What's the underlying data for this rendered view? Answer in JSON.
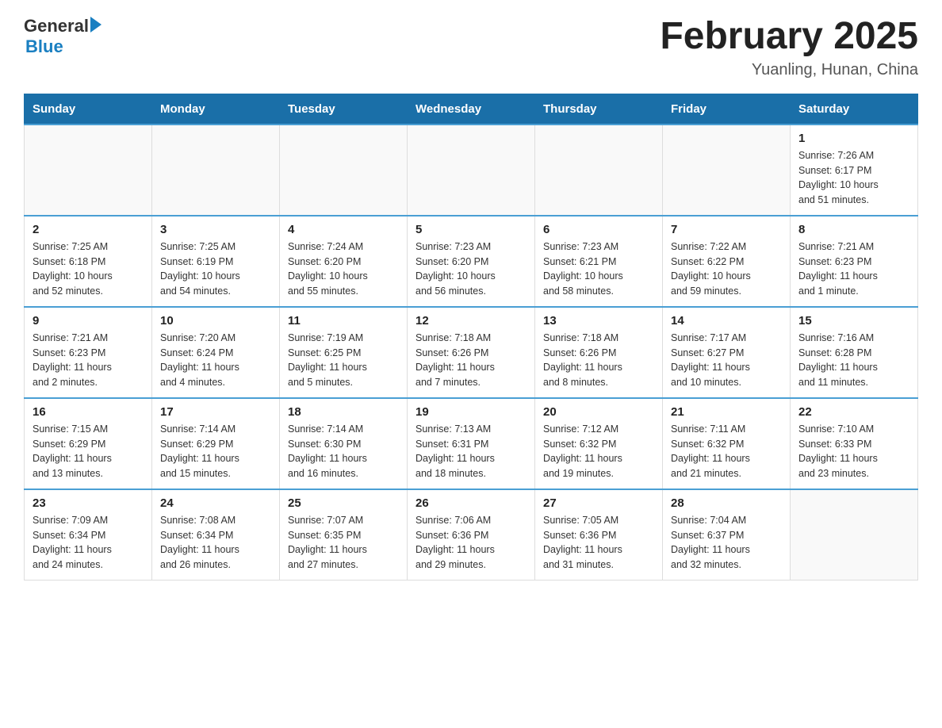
{
  "header": {
    "logo_general": "General",
    "logo_blue": "Blue",
    "title": "February 2025",
    "subtitle": "Yuanling, Hunan, China"
  },
  "days_of_week": [
    "Sunday",
    "Monday",
    "Tuesday",
    "Wednesday",
    "Thursday",
    "Friday",
    "Saturday"
  ],
  "weeks": [
    [
      {
        "day": "",
        "info": ""
      },
      {
        "day": "",
        "info": ""
      },
      {
        "day": "",
        "info": ""
      },
      {
        "day": "",
        "info": ""
      },
      {
        "day": "",
        "info": ""
      },
      {
        "day": "",
        "info": ""
      },
      {
        "day": "1",
        "info": "Sunrise: 7:26 AM\nSunset: 6:17 PM\nDaylight: 10 hours\nand 51 minutes."
      }
    ],
    [
      {
        "day": "2",
        "info": "Sunrise: 7:25 AM\nSunset: 6:18 PM\nDaylight: 10 hours\nand 52 minutes."
      },
      {
        "day": "3",
        "info": "Sunrise: 7:25 AM\nSunset: 6:19 PM\nDaylight: 10 hours\nand 54 minutes."
      },
      {
        "day": "4",
        "info": "Sunrise: 7:24 AM\nSunset: 6:20 PM\nDaylight: 10 hours\nand 55 minutes."
      },
      {
        "day": "5",
        "info": "Sunrise: 7:23 AM\nSunset: 6:20 PM\nDaylight: 10 hours\nand 56 minutes."
      },
      {
        "day": "6",
        "info": "Sunrise: 7:23 AM\nSunset: 6:21 PM\nDaylight: 10 hours\nand 58 minutes."
      },
      {
        "day": "7",
        "info": "Sunrise: 7:22 AM\nSunset: 6:22 PM\nDaylight: 10 hours\nand 59 minutes."
      },
      {
        "day": "8",
        "info": "Sunrise: 7:21 AM\nSunset: 6:23 PM\nDaylight: 11 hours\nand 1 minute."
      }
    ],
    [
      {
        "day": "9",
        "info": "Sunrise: 7:21 AM\nSunset: 6:23 PM\nDaylight: 11 hours\nand 2 minutes."
      },
      {
        "day": "10",
        "info": "Sunrise: 7:20 AM\nSunset: 6:24 PM\nDaylight: 11 hours\nand 4 minutes."
      },
      {
        "day": "11",
        "info": "Sunrise: 7:19 AM\nSunset: 6:25 PM\nDaylight: 11 hours\nand 5 minutes."
      },
      {
        "day": "12",
        "info": "Sunrise: 7:18 AM\nSunset: 6:26 PM\nDaylight: 11 hours\nand 7 minutes."
      },
      {
        "day": "13",
        "info": "Sunrise: 7:18 AM\nSunset: 6:26 PM\nDaylight: 11 hours\nand 8 minutes."
      },
      {
        "day": "14",
        "info": "Sunrise: 7:17 AM\nSunset: 6:27 PM\nDaylight: 11 hours\nand 10 minutes."
      },
      {
        "day": "15",
        "info": "Sunrise: 7:16 AM\nSunset: 6:28 PM\nDaylight: 11 hours\nand 11 minutes."
      }
    ],
    [
      {
        "day": "16",
        "info": "Sunrise: 7:15 AM\nSunset: 6:29 PM\nDaylight: 11 hours\nand 13 minutes."
      },
      {
        "day": "17",
        "info": "Sunrise: 7:14 AM\nSunset: 6:29 PM\nDaylight: 11 hours\nand 15 minutes."
      },
      {
        "day": "18",
        "info": "Sunrise: 7:14 AM\nSunset: 6:30 PM\nDaylight: 11 hours\nand 16 minutes."
      },
      {
        "day": "19",
        "info": "Sunrise: 7:13 AM\nSunset: 6:31 PM\nDaylight: 11 hours\nand 18 minutes."
      },
      {
        "day": "20",
        "info": "Sunrise: 7:12 AM\nSunset: 6:32 PM\nDaylight: 11 hours\nand 19 minutes."
      },
      {
        "day": "21",
        "info": "Sunrise: 7:11 AM\nSunset: 6:32 PM\nDaylight: 11 hours\nand 21 minutes."
      },
      {
        "day": "22",
        "info": "Sunrise: 7:10 AM\nSunset: 6:33 PM\nDaylight: 11 hours\nand 23 minutes."
      }
    ],
    [
      {
        "day": "23",
        "info": "Sunrise: 7:09 AM\nSunset: 6:34 PM\nDaylight: 11 hours\nand 24 minutes."
      },
      {
        "day": "24",
        "info": "Sunrise: 7:08 AM\nSunset: 6:34 PM\nDaylight: 11 hours\nand 26 minutes."
      },
      {
        "day": "25",
        "info": "Sunrise: 7:07 AM\nSunset: 6:35 PM\nDaylight: 11 hours\nand 27 minutes."
      },
      {
        "day": "26",
        "info": "Sunrise: 7:06 AM\nSunset: 6:36 PM\nDaylight: 11 hours\nand 29 minutes."
      },
      {
        "day": "27",
        "info": "Sunrise: 7:05 AM\nSunset: 6:36 PM\nDaylight: 11 hours\nand 31 minutes."
      },
      {
        "day": "28",
        "info": "Sunrise: 7:04 AM\nSunset: 6:37 PM\nDaylight: 11 hours\nand 32 minutes."
      },
      {
        "day": "",
        "info": ""
      }
    ]
  ]
}
